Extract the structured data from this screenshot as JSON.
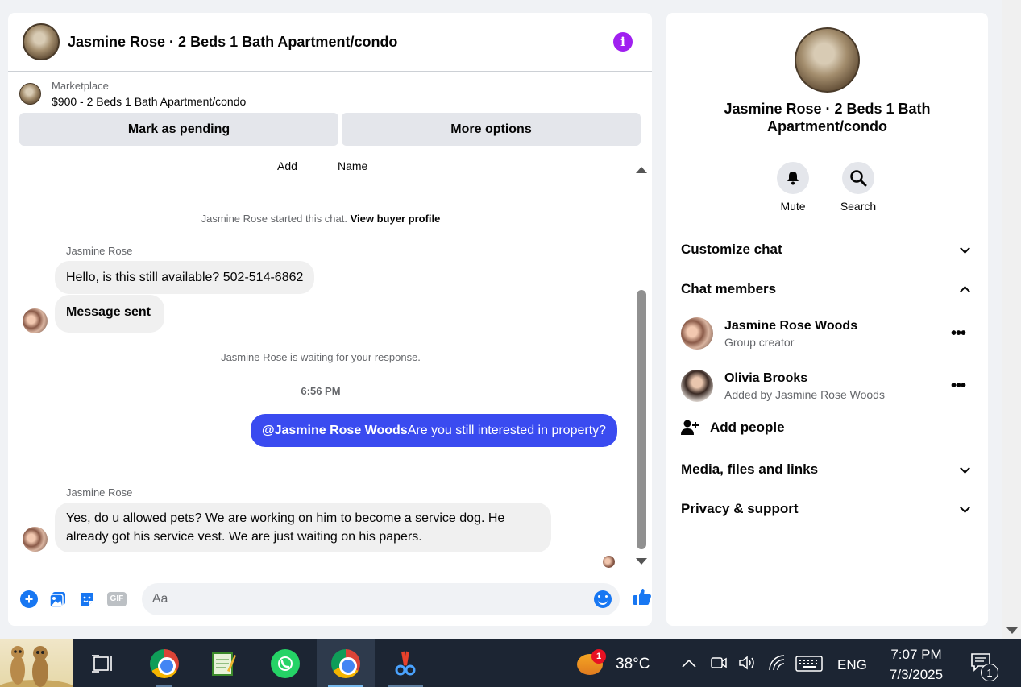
{
  "chat": {
    "title": "Jasmine Rose · 2 Beds 1 Bath Apartment/condo",
    "marketplace_label": "Marketplace",
    "listing": "$900 - 2 Beds 1 Bath Apartment/condo",
    "mark_pending": "Mark as pending",
    "more_options": "More options",
    "top_add": "Add",
    "top_name": "Name",
    "started_text": "Jasmine Rose started this chat.",
    "view_buyer_profile": "View buyer profile",
    "sender1": "Jasmine Rose",
    "msg1": "Hello, is this still available? 502-514-6862",
    "msg2": "Message sent",
    "waiting_text": "Jasmine Rose is waiting for your response.",
    "time_sep": "6:56 PM",
    "out_mention": "@Jasmine Rose Woods",
    "out_text": "Are you still interested in property?",
    "sender2": "Jasmine Rose",
    "msg3": "Yes, do u allowed pets? We are working on him to become a service dog. He already got his service vest.  We are just waiting on his papers.",
    "composer_placeholder": "Aa",
    "gif_label": "GIF"
  },
  "details": {
    "title": "Jasmine Rose · 2 Beds 1 Bath Apartment/condo",
    "mute": "Mute",
    "search": "Search",
    "customize_chat": "Customize chat",
    "chat_members": "Chat members",
    "members": [
      {
        "name": "Jasmine Rose Woods",
        "sub": "Group creator"
      },
      {
        "name": "Olivia Brooks",
        "sub": "Added by Jasmine Rose Woods"
      }
    ],
    "add_people": "Add people",
    "media_files_links": "Media, files and links",
    "privacy_support": "Privacy & support"
  },
  "taskbar": {
    "weather_badge": "1",
    "temperature": "38°C",
    "language": "ENG",
    "time": "7:07 PM",
    "date": "7/3/2025",
    "notifications": "1"
  },
  "colors": {
    "accent": "#3a4bf0",
    "info": "#a020f0",
    "messenger_blue": "#1877f2"
  }
}
